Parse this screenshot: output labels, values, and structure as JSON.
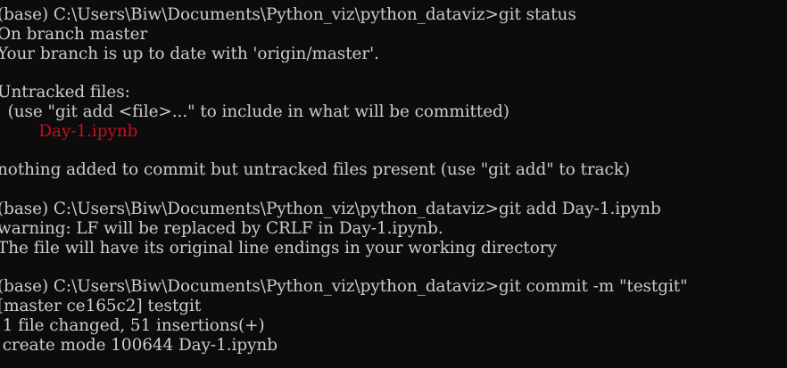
{
  "colors": {
    "background": "#0c0c0c",
    "text": "#cccccc",
    "untracked_file": "#c50f1f"
  },
  "terminal": {
    "lines": [
      {
        "text": "(base) C:\\Users\\Biw\\Documents\\Python_viz\\python_dataviz>git status"
      },
      {
        "text": "On branch master"
      },
      {
        "text": "Your branch is up to date with 'origin/master'."
      },
      {
        "text": ""
      },
      {
        "text": "Untracked files:"
      },
      {
        "text": "  (use \"git add <file>...\" to include in what will be committed)"
      },
      {
        "text": "        Day-1.ipynb",
        "color": "red"
      },
      {
        "text": ""
      },
      {
        "text": "nothing added to commit but untracked files present (use \"git add\" to track)"
      },
      {
        "text": ""
      },
      {
        "text": "(base) C:\\Users\\Biw\\Documents\\Python_viz\\python_dataviz>git add Day-1.ipynb"
      },
      {
        "text": "warning: LF will be replaced by CRLF in Day-1.ipynb."
      },
      {
        "text": "The file will have its original line endings in your working directory"
      },
      {
        "text": ""
      },
      {
        "text": "(base) C:\\Users\\Biw\\Documents\\Python_viz\\python_dataviz>git commit -m \"testgit\""
      },
      {
        "text": "[master ce165c2] testgit"
      },
      {
        "text": " 1 file changed, 51 insertions(+)"
      },
      {
        "text": " create mode 100644 Day-1.ipynb"
      }
    ]
  }
}
